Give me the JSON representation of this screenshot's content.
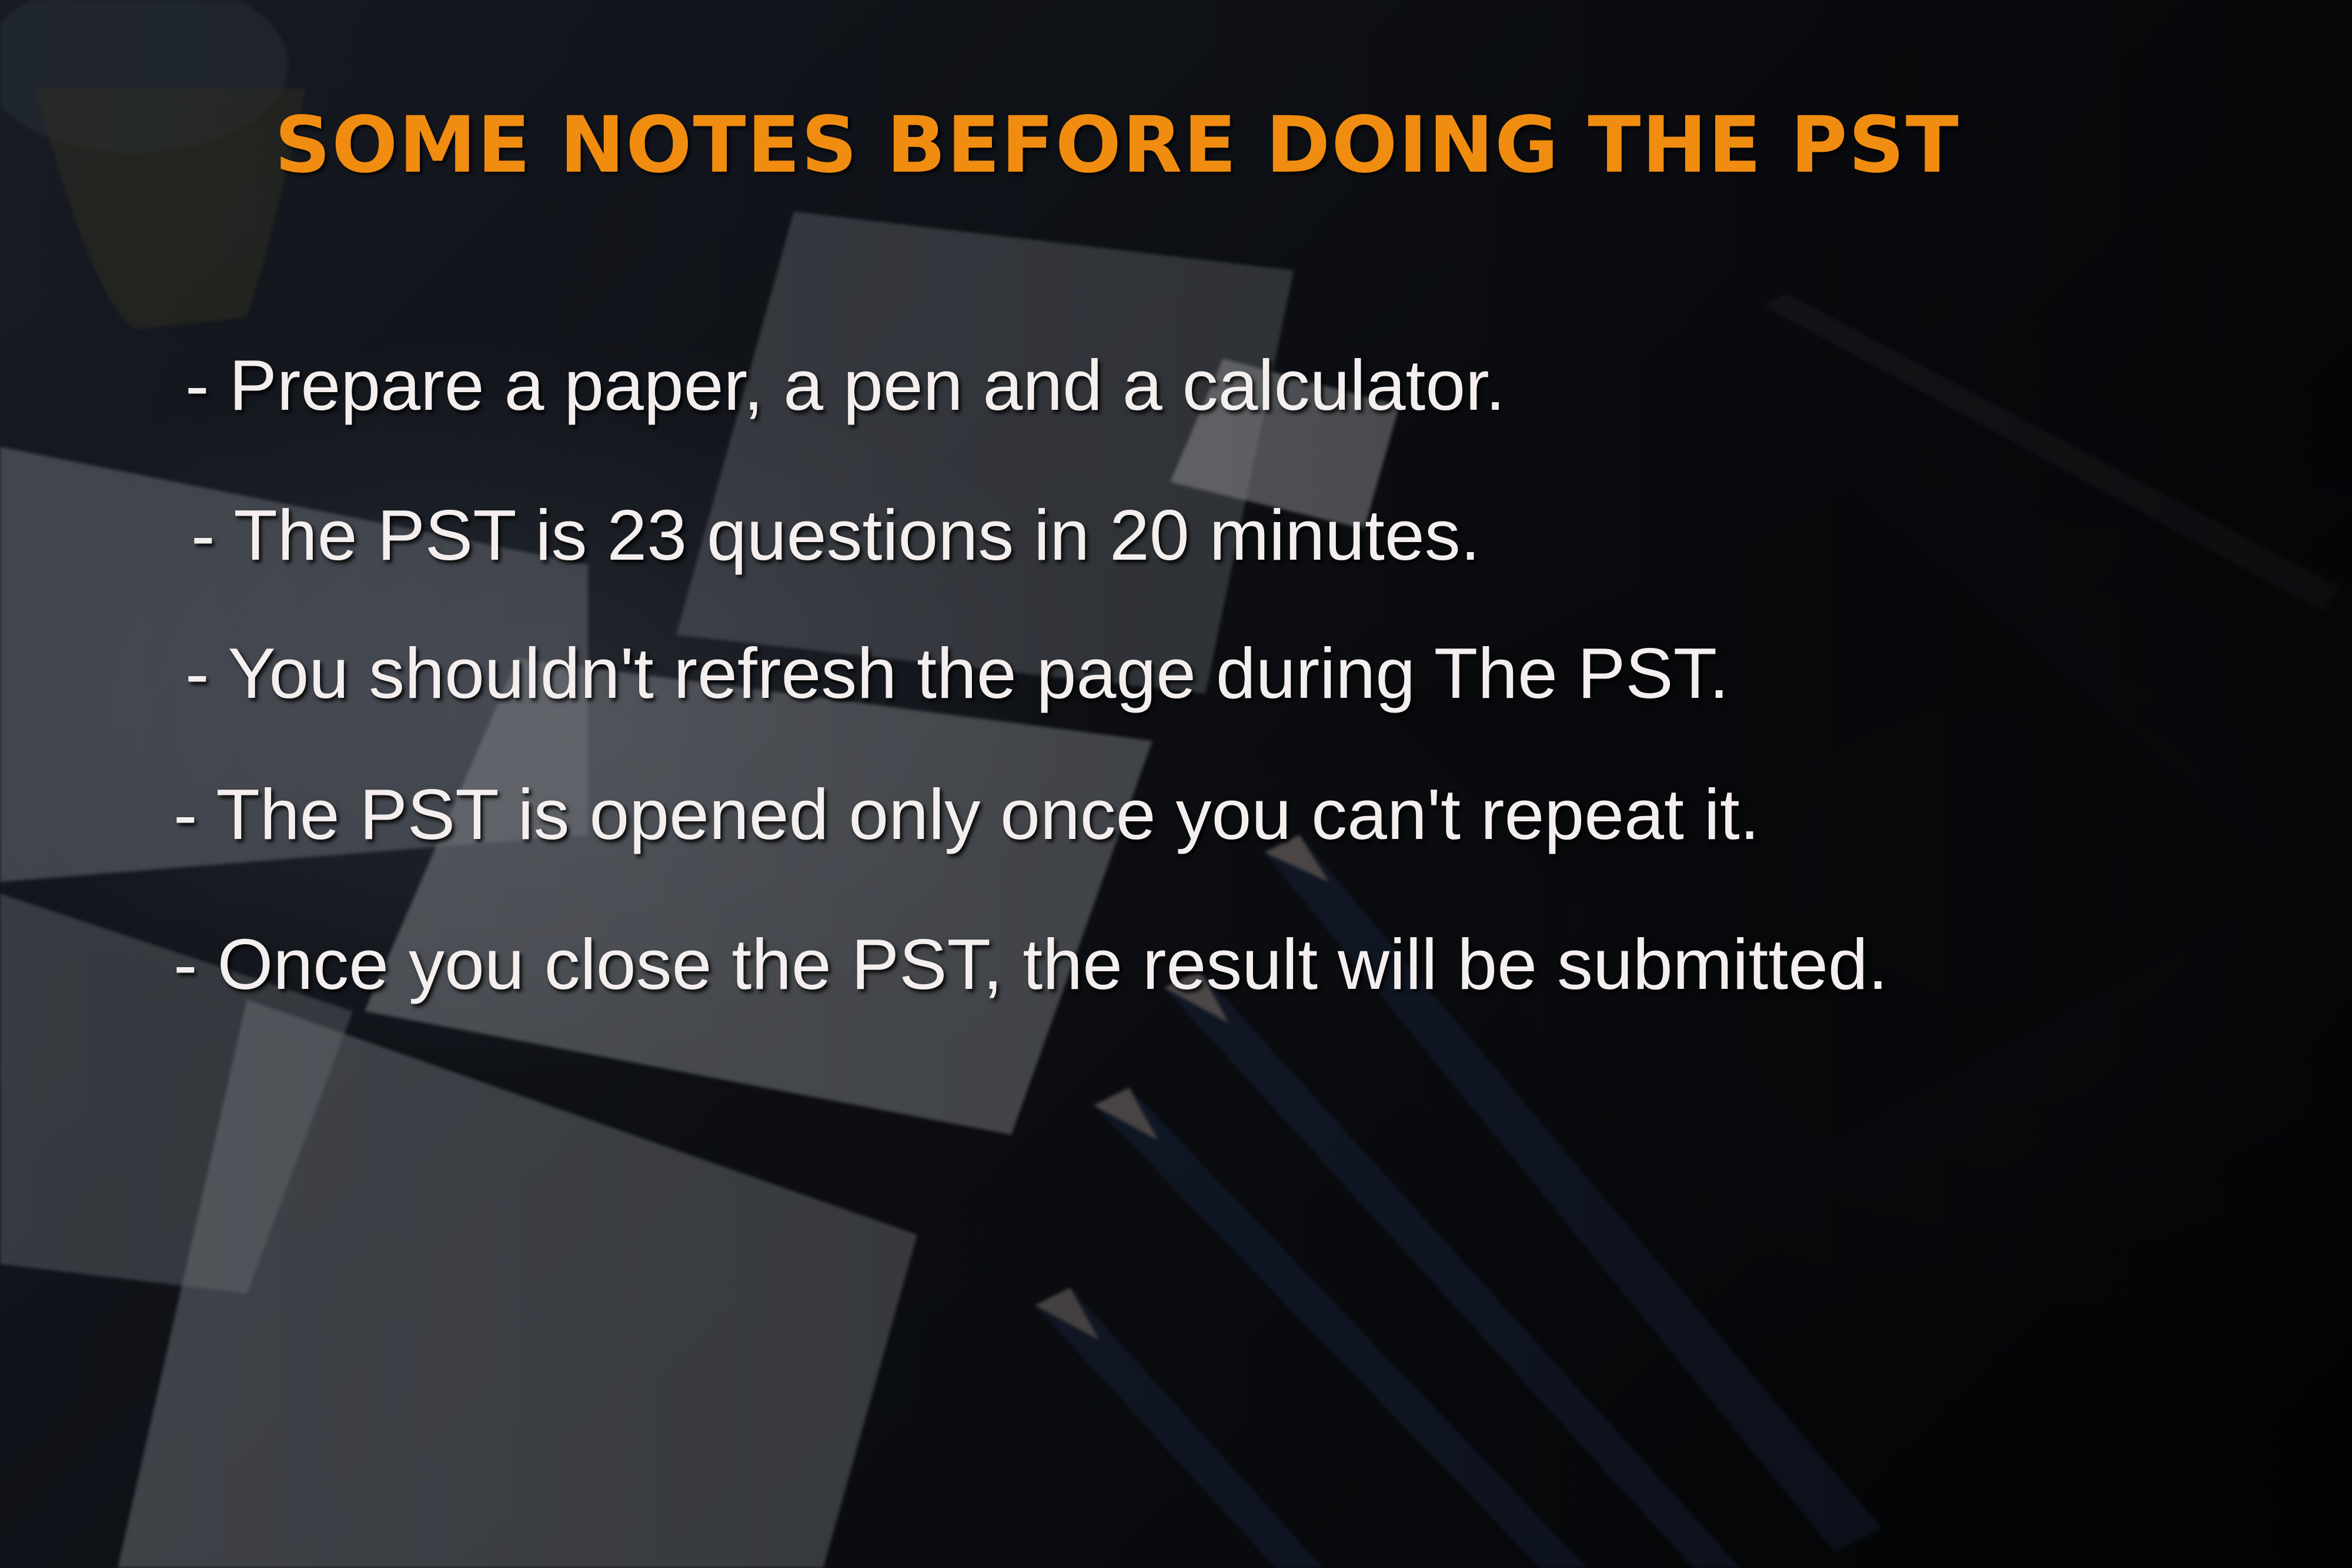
{
  "title": "SOME NOTES BEFORE DOING THE PST",
  "notes": [
    "- Prepare a paper, a pen and a calculator.",
    "- The PST is 23 questions in 20 minutes.",
    "- You shouldn't refresh the page during The PST.",
    "- The PST is opened only once you can't repeat it.",
    "- Once you close the PST, the result will be submitted."
  ],
  "colors": {
    "title": "#f08c10",
    "text": "#f4efee",
    "background": "#12151c"
  }
}
